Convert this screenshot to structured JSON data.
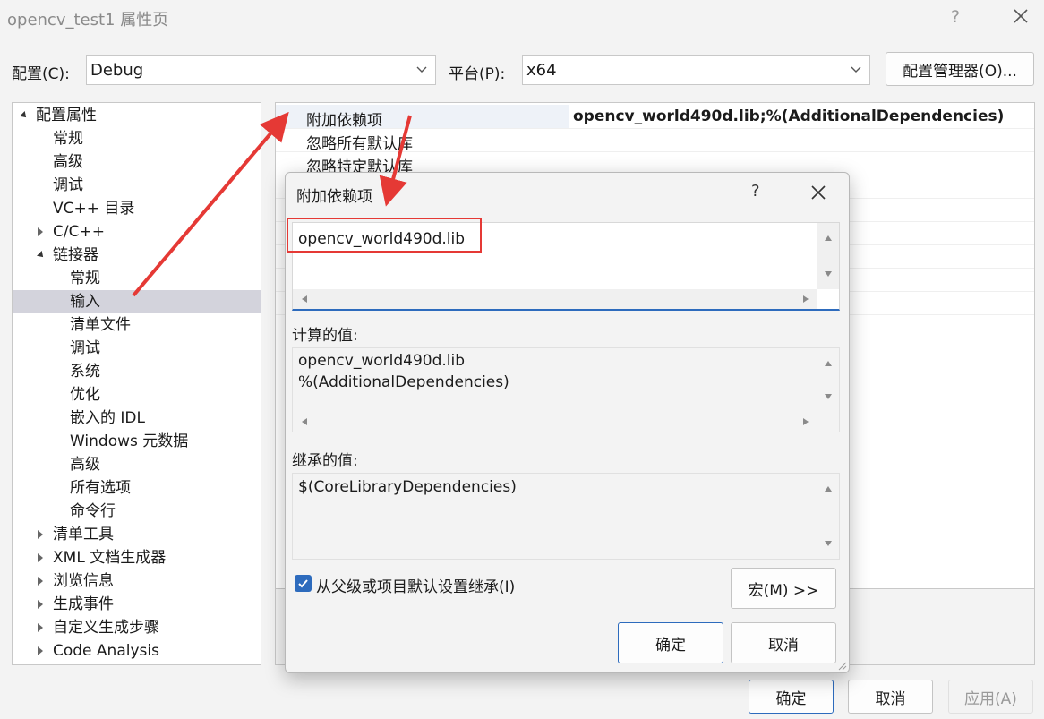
{
  "window": {
    "title": "opencv_test1 属性页",
    "help_label": "?"
  },
  "toolbar": {
    "config_label": "配置(C):",
    "config_value": "Debug",
    "platform_label": "平台(P):",
    "platform_value": "x64",
    "config_manager_button": "配置管理器(O)..."
  },
  "tree": {
    "items": [
      {
        "label": "配置属性",
        "level": 0,
        "expand": "expanded"
      },
      {
        "label": "常规",
        "level": 1
      },
      {
        "label": "高级",
        "level": 1
      },
      {
        "label": "调试",
        "level": 1
      },
      {
        "label": "VC++ 目录",
        "level": 1
      },
      {
        "label": "C/C++",
        "level": 1,
        "expand": "collapsed"
      },
      {
        "label": "链接器",
        "level": 1,
        "expand": "expanded"
      },
      {
        "label": "常规",
        "level": 2
      },
      {
        "label": "输入",
        "level": 2,
        "selected": true
      },
      {
        "label": "清单文件",
        "level": 2
      },
      {
        "label": "调试",
        "level": 2
      },
      {
        "label": "系统",
        "level": 2
      },
      {
        "label": "优化",
        "level": 2
      },
      {
        "label": "嵌入的 IDL",
        "level": 2
      },
      {
        "label": "Windows 元数据",
        "level": 2
      },
      {
        "label": "高级",
        "level": 2
      },
      {
        "label": "所有选项",
        "level": 2
      },
      {
        "label": "命令行",
        "level": 2
      },
      {
        "label": "清单工具",
        "level": 1,
        "expand": "collapsed"
      },
      {
        "label": "XML 文档生成器",
        "level": 1,
        "expand": "collapsed"
      },
      {
        "label": "浏览信息",
        "level": 1,
        "expand": "collapsed"
      },
      {
        "label": "生成事件",
        "level": 1,
        "expand": "collapsed"
      },
      {
        "label": "自定义生成步骤",
        "level": 1,
        "expand": "collapsed"
      },
      {
        "label": "Code Analysis",
        "level": 1,
        "expand": "collapsed"
      }
    ]
  },
  "properties": {
    "rows": [
      {
        "name": "附加依赖项",
        "value": "opencv_world490d.lib;%(AdditionalDependencies)"
      },
      {
        "name": "忽略所有默认库",
        "value": ""
      },
      {
        "name": "忽略特定默认库",
        "value": ""
      }
    ]
  },
  "dialog": {
    "title": "附加依赖项",
    "help_label": "?",
    "edit_value": "opencv_world490d.lib",
    "computed_label": "计算的值:",
    "computed_lines": [
      "opencv_world490d.lib",
      "%(AdditionalDependencies)"
    ],
    "inherited_label": "继承的值:",
    "inherited_lines": [
      "$(CoreLibraryDependencies)"
    ],
    "inherit_checkbox_label": "从父级或项目默认设置继承(I)",
    "inherit_checked": true,
    "macros_button": "宏(M) >>",
    "ok_button": "确定",
    "cancel_button": "取消"
  },
  "footer": {
    "ok_button": "确定",
    "cancel_button": "取消",
    "apply_button": "应用(A)"
  },
  "colors": {
    "accent": "#2d6bbd",
    "annotation_red": "#e53935",
    "selected_tree": "#d3d3dc"
  }
}
